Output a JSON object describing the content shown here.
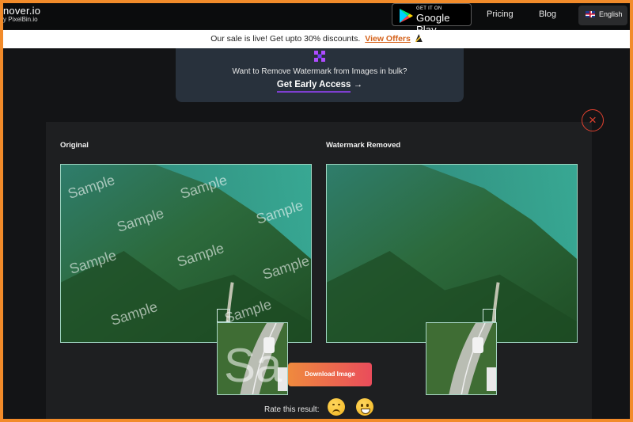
{
  "header": {
    "brand_name": "nover.io",
    "brand_by": "y PixelBin.io",
    "gplay_small": "GET IT ON",
    "gplay_big": "Google Play",
    "nav": [
      "Pricing",
      "Blog"
    ],
    "language": "English"
  },
  "sale_banner": {
    "text": "Our sale is live! Get upto 30% discounts.",
    "offer_link": "View Offers",
    "icon": "party-hat-icon"
  },
  "promo": {
    "question": "Want to Remove Watermark from Images in bulk?",
    "cta": "Get Early Access",
    "cta_arrow": "→"
  },
  "result": {
    "original_title": "Original",
    "removed_title": "Watermark Removed",
    "watermark_text": "Sample",
    "zoom_watermark_text": "Sa",
    "download_label": "Download Image",
    "close_symbol": "×",
    "rate_label": "Rate this result:"
  },
  "colors": {
    "accent": "#f28b2a",
    "close": "#e0412f",
    "download_start": "#ef8a3e",
    "download_end": "#ea4c5b",
    "cta_underline": "#7d3fd0"
  }
}
